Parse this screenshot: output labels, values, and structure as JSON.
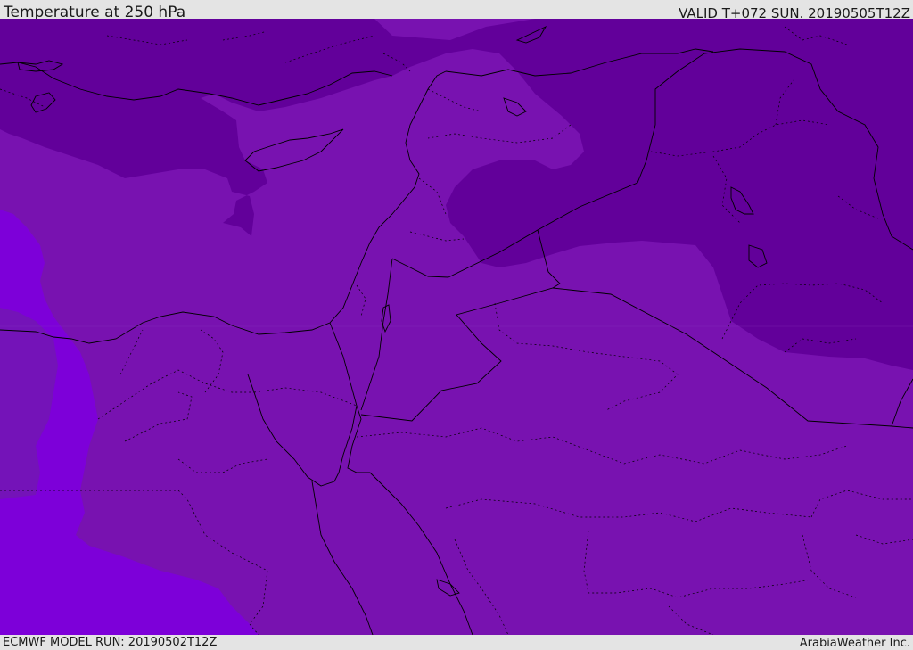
{
  "header": {
    "title": "Temperature at 250 hPa",
    "valid": "VALID T+072 SUN. 20190505T12Z"
  },
  "footer": {
    "model_run": "ECMWF MODEL RUN: 20190502T12Z",
    "credit": "ArabiaWeather Inc."
  },
  "map": {
    "field": "temperature",
    "level": "250 hPa",
    "colors": {
      "coldest": "#62009a",
      "middle": "#7812b0",
      "warmest": "#7d00d9",
      "border": "#000000"
    }
  }
}
